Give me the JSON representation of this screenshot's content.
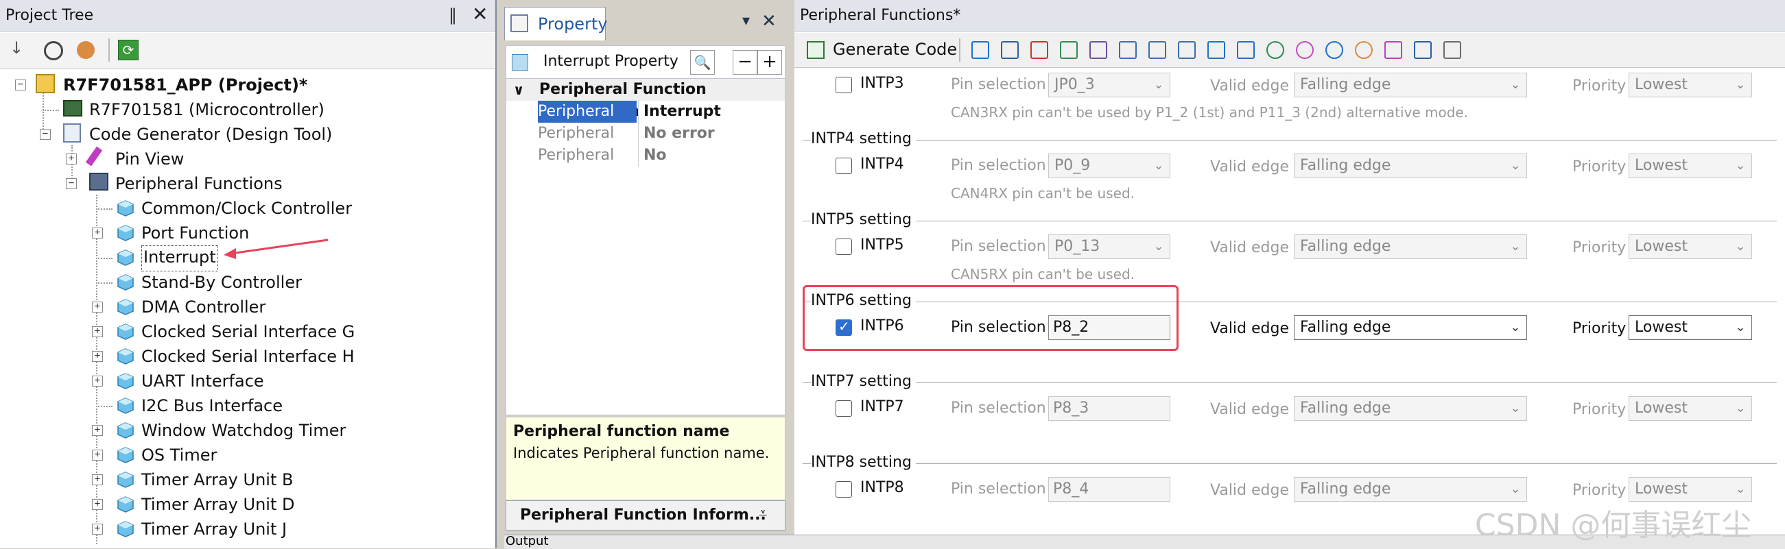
{
  "project_tree": {
    "title": "Project Tree",
    "pin_glyph": "‖",
    "close_glyph": "✕",
    "items": [
      {
        "label": "R7F701581_APP (Project)*"
      },
      {
        "label": "R7F701581 (Microcontroller)"
      },
      {
        "label": "Code Generator (Design Tool)"
      },
      {
        "label": "Pin View"
      },
      {
        "label": "Peripheral Functions"
      },
      {
        "label": "Common/Clock Controller"
      },
      {
        "label": "Port Function"
      },
      {
        "label": "Interrupt"
      },
      {
        "label": "Stand-By Controller"
      },
      {
        "label": "DMA Controller"
      },
      {
        "label": "Clocked Serial Interface G"
      },
      {
        "label": "Clocked Serial Interface H"
      },
      {
        "label": "UART Interface"
      },
      {
        "label": "I2C Bus Interface"
      },
      {
        "label": "Window Watchdog Timer"
      },
      {
        "label": "OS Timer"
      },
      {
        "label": "Timer Array Unit B"
      },
      {
        "label": "Timer Array Unit D"
      },
      {
        "label": "Timer Array Unit J"
      }
    ]
  },
  "property": {
    "tab_label": "Property",
    "header_label": "Interrupt Property",
    "category": "Peripheral Function Information",
    "rows": [
      {
        "name": "Peripheral fun",
        "value": "Interrupt"
      },
      {
        "name": "Peripheral fun",
        "value": "No error"
      },
      {
        "name": "Peripheral fun",
        "value": "No"
      }
    ],
    "desc_title": "Peripheral function name",
    "desc_text": "Indicates Peripheral function name.",
    "bottom_tab": "Peripheral Function Inform..."
  },
  "peripheral": {
    "title": "Peripheral Functions*",
    "generate_label": "Generate Code",
    "labels": {
      "pin_selection": "Pin selection",
      "valid_edge": "Valid edge",
      "priority": "Priority"
    },
    "intp": [
      {
        "section": "",
        "name": "INTP3",
        "pin": "JP0_3",
        "edge": "Falling edge",
        "priority": "Lowest",
        "note": "CAN3RX pin can't be used by P1_2 (1st) and P11_3 (2nd) alternative mode.",
        "checked": false
      },
      {
        "section": "INTP4 setting",
        "name": "INTP4",
        "pin": "P0_9",
        "edge": "Falling edge",
        "priority": "Lowest",
        "note": "CAN4RX pin can't be used.",
        "checked": false
      },
      {
        "section": "INTP5 setting",
        "name": "INTP5",
        "pin": "P0_13",
        "edge": "Falling edge",
        "priority": "Lowest",
        "note": "CAN5RX pin can't be used.",
        "checked": false
      },
      {
        "section": "INTP6 setting",
        "name": "INTP6",
        "pin": "P8_2",
        "edge": "Falling edge",
        "priority": "Lowest",
        "note": "",
        "checked": true
      },
      {
        "section": "INTP7 setting",
        "name": "INTP7",
        "pin": "P8_3",
        "edge": "Falling edge",
        "priority": "Lowest",
        "note": "",
        "checked": false
      },
      {
        "section": "INTP8 setting",
        "name": "INTP8",
        "pin": "P8_4",
        "edge": "Falling edge",
        "priority": "Lowest",
        "note": "",
        "checked": false
      }
    ]
  },
  "bottom": {
    "output_label": "Output"
  },
  "watermark": "CSDN @何事误红尘",
  "colors": {
    "highlight": "#e8425a",
    "accent": "#2d6fd1",
    "selection": "#3169c6"
  }
}
